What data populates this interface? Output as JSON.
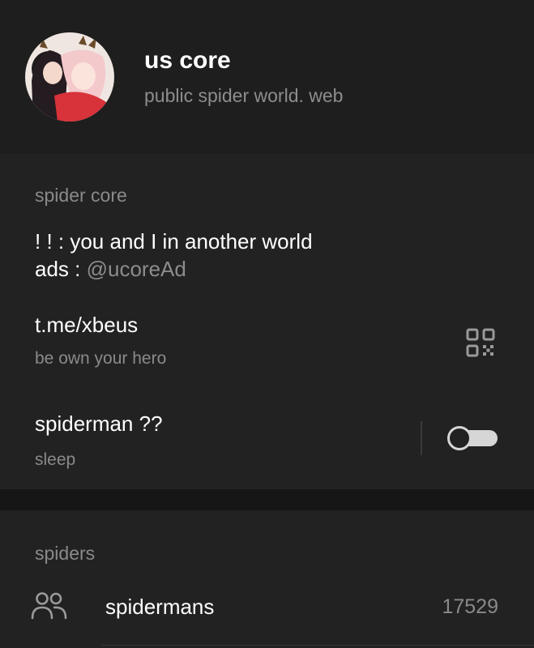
{
  "channel": {
    "title": "us core",
    "subtitle": "public spider world. web"
  },
  "info": {
    "section_label": "spider core",
    "description_line1": "! !  : you and I in another world",
    "description_ads_prefix": "ads : ",
    "description_ads_handle": "@ucoreAd",
    "link": "t.me/xbeus",
    "link_subtitle": "be own your hero",
    "notifications_title": "spiderman ??",
    "notifications_subtitle": "sleep",
    "notifications_enabled": false
  },
  "members": {
    "section_label": "spiders",
    "row_label": "spidermans",
    "count": "17529"
  },
  "icons": {
    "qr": "qr-code-icon",
    "people": "people-icon"
  },
  "colors": {
    "background": "#181818",
    "panel": "#222222",
    "header": "#1e1e1e",
    "primary_text": "#ffffff",
    "secondary_text": "#8a8a8a"
  }
}
